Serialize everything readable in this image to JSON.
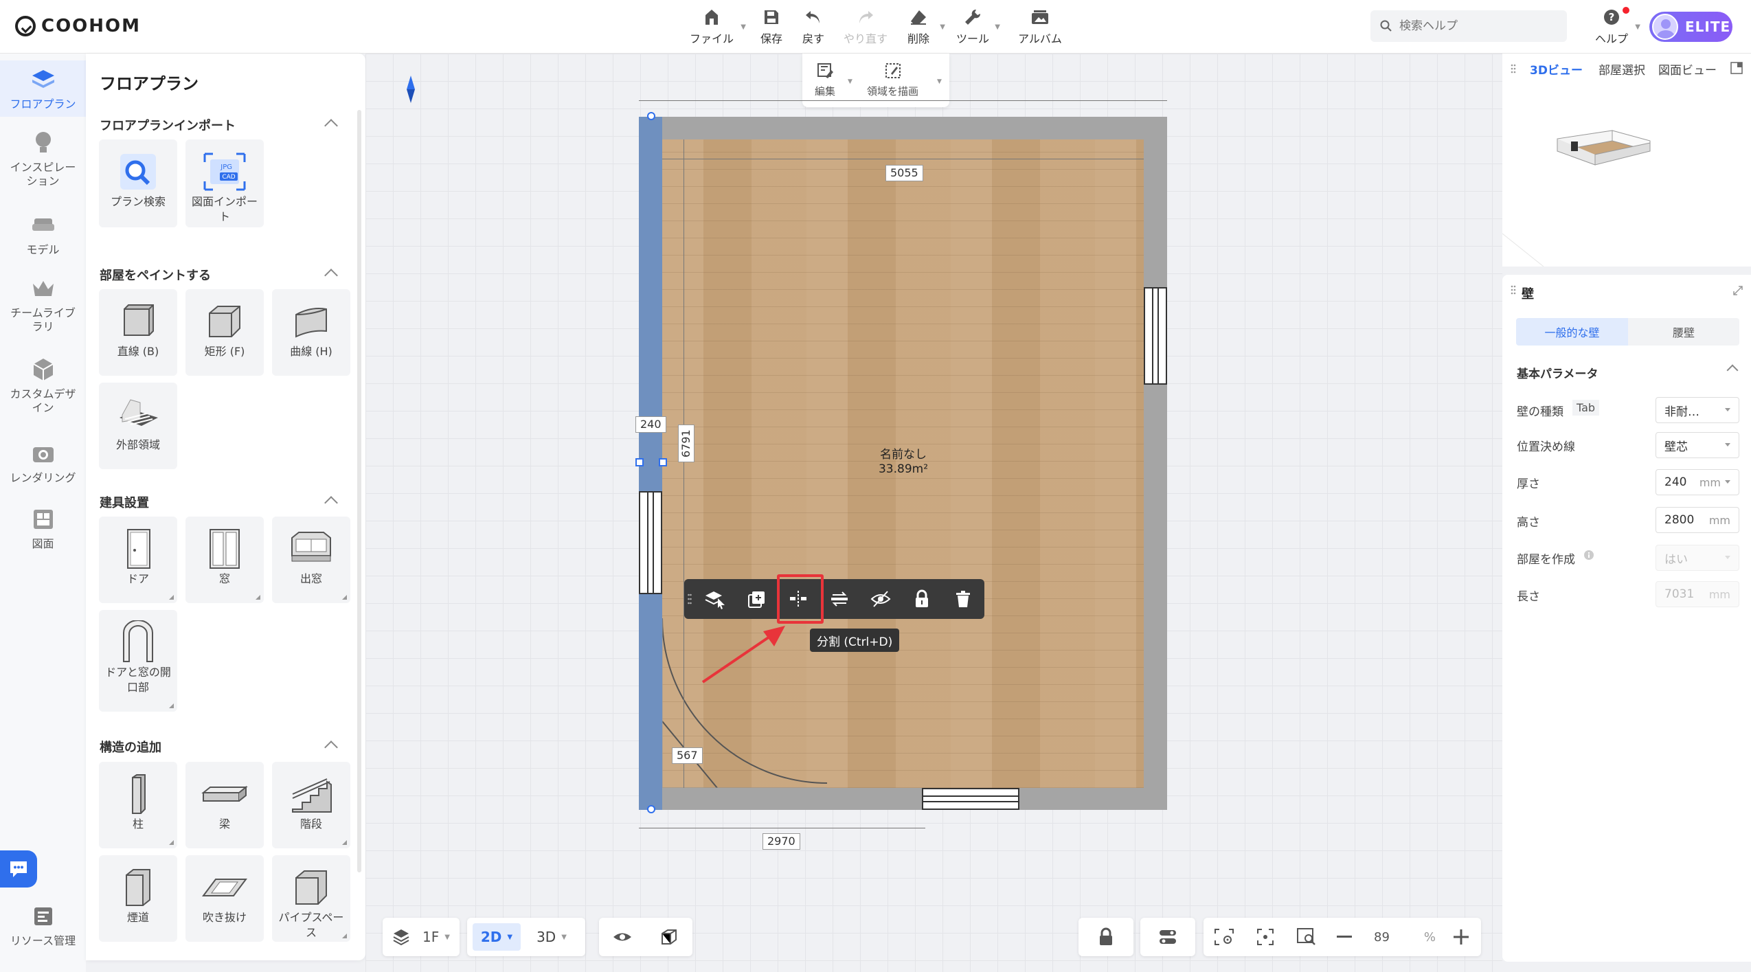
{
  "app": {
    "brand": "COOHOM"
  },
  "toolbar": {
    "file": "ファイル",
    "save": "保存",
    "undo": "戻す",
    "redo": "やり直す",
    "delete": "削除",
    "tools": "ツール",
    "album": "アルバム"
  },
  "search": {
    "placeholder": "検索ヘルプ"
  },
  "help": {
    "label": "ヘルプ"
  },
  "account": {
    "badge": "ELITE"
  },
  "leftnav": {
    "items": [
      {
        "label": "フロアプラン"
      },
      {
        "label": "インスピレーション"
      },
      {
        "label": "モデル"
      },
      {
        "label": "チームライブラリ"
      },
      {
        "label": "カスタムデザイン"
      },
      {
        "label": "レンダリング"
      },
      {
        "label": "図面"
      }
    ],
    "resource": "リソース管理"
  },
  "panel": {
    "title": "フロアプラン",
    "sections": [
      {
        "title": "フロアプランインポート",
        "tiles": [
          "プラン検索",
          "図面インポート"
        ]
      },
      {
        "title": "部屋をペイントする",
        "tiles": [
          "直線 (B)",
          "矩形 (F)",
          "曲線 (H)",
          "外部領域"
        ]
      },
      {
        "title": "建具設置",
        "tiles": [
          "ドア",
          "窓",
          "出窓",
          "ドアと窓の開口部"
        ]
      },
      {
        "title": "構造の追加",
        "tiles": [
          "柱",
          "梁",
          "階段",
          "煙道",
          "吹き抜け",
          "パイプスペース"
        ]
      }
    ],
    "import_icon_text": {
      "jpg": "JPG",
      "cad": "CAD"
    }
  },
  "edit_toolbar": {
    "edit": "編集",
    "draw_area": "領域を描画"
  },
  "room": {
    "name": "名前なし",
    "area": "33.89m²",
    "dims": {
      "top": "5055",
      "bottom": "2970",
      "left_height": "6791",
      "thickness": "240",
      "small": "567"
    }
  },
  "context_toolbar": {
    "tooltip": "分割 (Ctrl+D)"
  },
  "right_view": {
    "tabs": [
      "3Dビュー",
      "部屋選択",
      "図面ビュー"
    ]
  },
  "wall_panel": {
    "title": "壁",
    "tabs": [
      "一般的な壁",
      "腰壁"
    ],
    "section": "基本パラメータ",
    "params": [
      {
        "label": "壁の種類",
        "tag": "Tab",
        "value": "非耐…"
      },
      {
        "label": "位置決め線",
        "value": "壁芯"
      },
      {
        "label": "厚さ",
        "value": "240",
        "unit": "mm"
      },
      {
        "label": "高さ",
        "value": "2800",
        "unit": "mm"
      },
      {
        "label": "部屋を作成",
        "value": "はい"
      },
      {
        "label": "長さ",
        "value": "7031",
        "unit": "mm"
      }
    ]
  },
  "bottom": {
    "floor": "1F",
    "mode2d": "2D",
    "mode3d": "3D",
    "zoom": "89",
    "zoom_unit": "%"
  },
  "colors": {
    "accent": "#2f6fec",
    "highlight": "#e8343a",
    "wall_selected": "#6f90bf",
    "wall": "#a5a5a5"
  }
}
